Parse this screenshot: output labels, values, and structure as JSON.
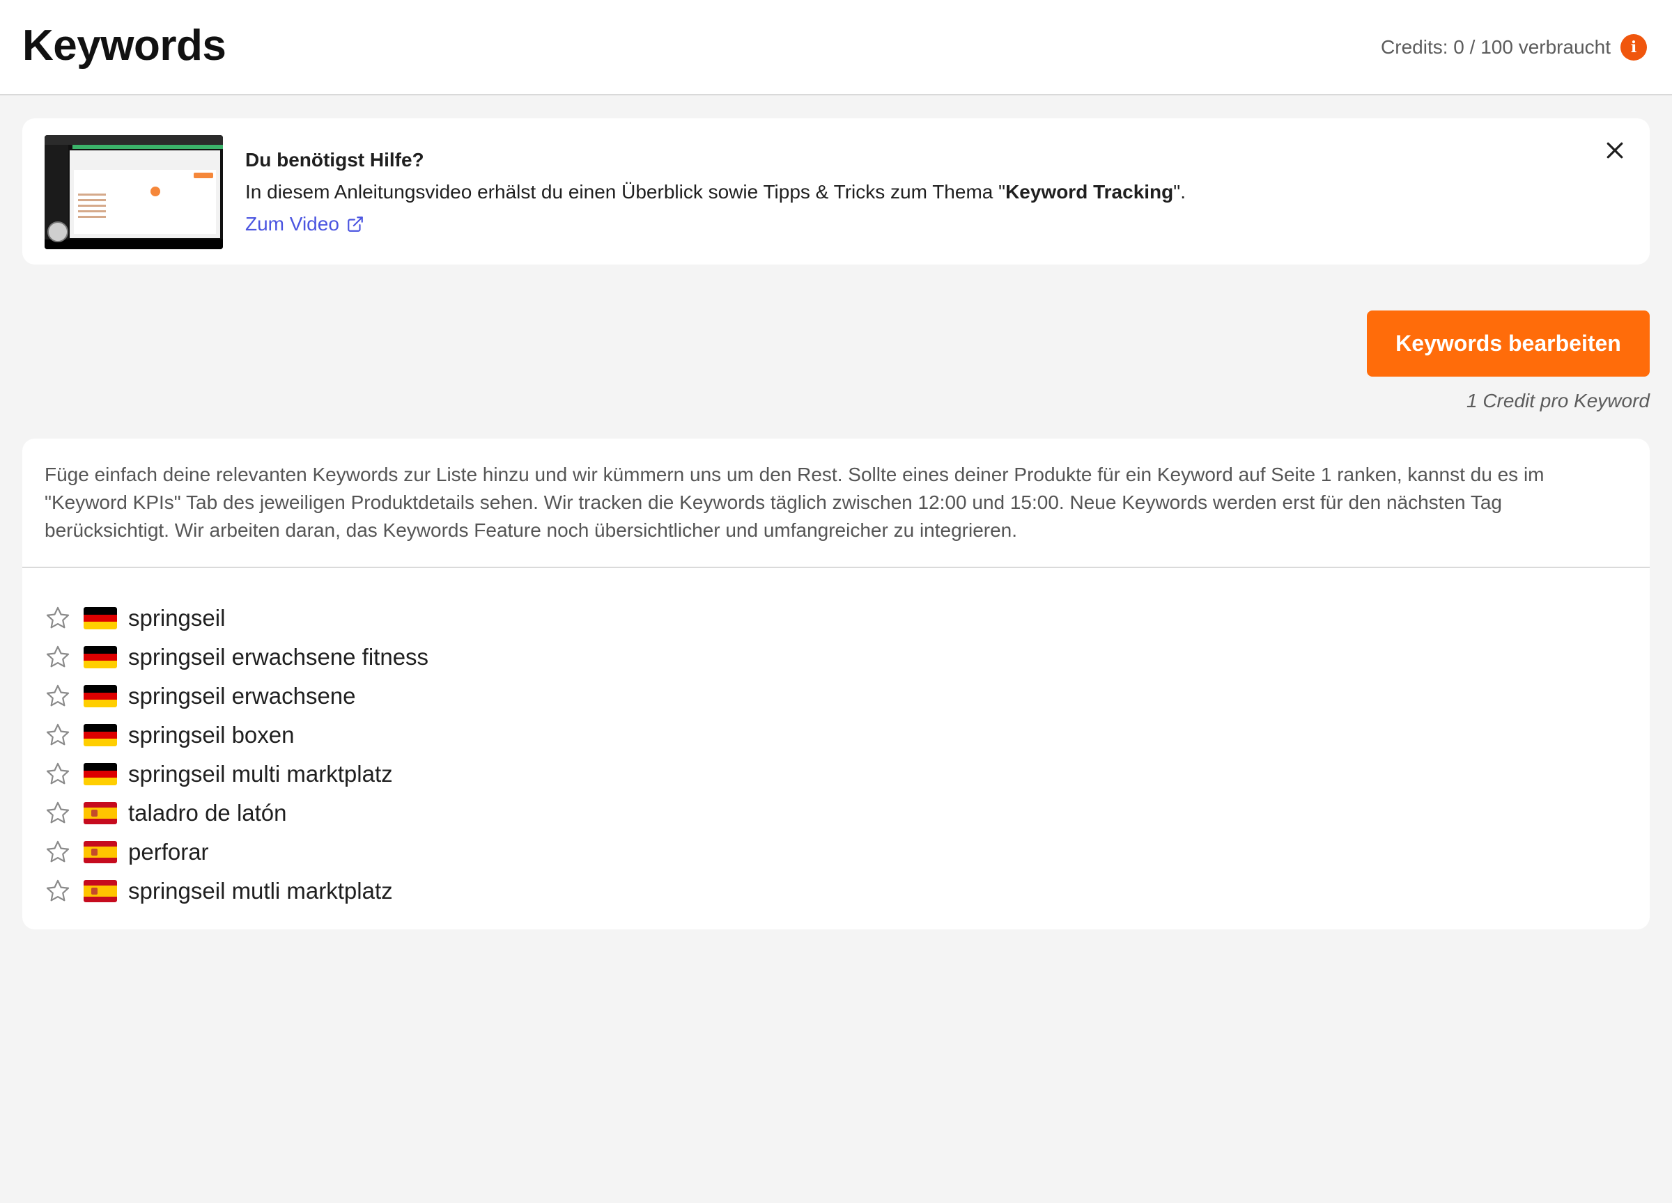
{
  "header": {
    "title": "Keywords",
    "credits_text": "Credits: 0 / 100 verbraucht",
    "info_glyph": "i"
  },
  "help": {
    "title": "Du benötigst Hilfe?",
    "text_before": "In diesem Anleitungsvideo erhälst du einen Überblick sowie Tipps & Tricks zum Thema \"",
    "text_bold": "Keyword Tracking",
    "text_after": "\".",
    "link_label": "Zum Video"
  },
  "actions": {
    "edit_label": "Keywords bearbeiten",
    "credit_note": "1 Credit pro Keyword"
  },
  "keywords_card": {
    "description": "Füge einfach deine relevanten Keywords zur Liste hinzu und wir kümmern uns um den Rest. Sollte eines deiner Produkte für ein Keyword auf Seite 1 ranken, kannst du es im \"Keyword KPIs\" Tab des jeweiligen Produktdetails sehen. Wir tracken die Keywords täglich zwischen 12:00 und 15:00. Neue Keywords werden erst für den nächsten Tag berücksichtigt. Wir arbeiten daran, das Keywords Feature noch übersichtlicher und umfangreicher zu integrieren.",
    "items": [
      {
        "label": "springseil",
        "flag": "de"
      },
      {
        "label": "springseil erwachsene fitness",
        "flag": "de"
      },
      {
        "label": "springseil erwachsene",
        "flag": "de"
      },
      {
        "label": "springseil boxen",
        "flag": "de"
      },
      {
        "label": "springseil multi marktplatz",
        "flag": "de"
      },
      {
        "label": "taladro de latón",
        "flag": "es"
      },
      {
        "label": "perforar",
        "flag": "es"
      },
      {
        "label": "springseil mutli marktplatz",
        "flag": "es"
      }
    ]
  },
  "colors": {
    "accent": "#ff6c0a",
    "info": "#f0560d",
    "link": "#4b55e0",
    "background": "#f4f4f4"
  },
  "icons": {
    "info": "info-icon",
    "close": "close-icon",
    "external": "external-link-icon",
    "star": "star-outline-icon",
    "flag_de": "flag-germany-icon",
    "flag_es": "flag-spain-icon"
  }
}
